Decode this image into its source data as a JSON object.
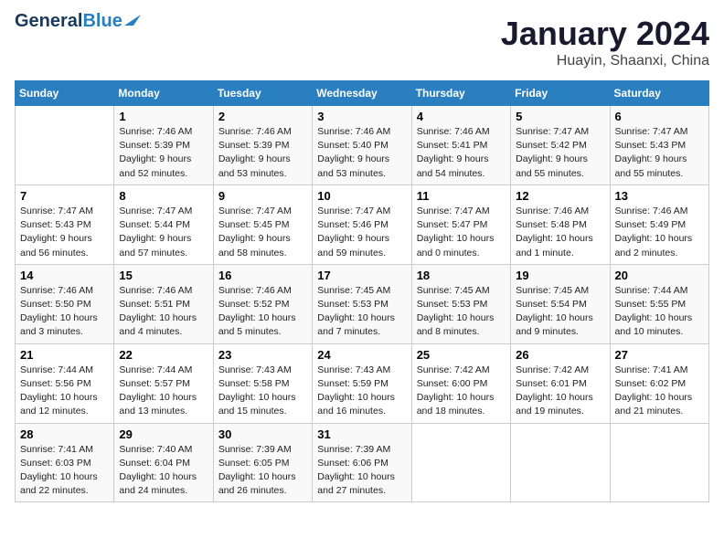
{
  "header": {
    "logo_general": "General",
    "logo_blue": "Blue",
    "month": "January 2024",
    "location": "Huayin, Shaanxi, China"
  },
  "days_of_week": [
    "Sunday",
    "Monday",
    "Tuesday",
    "Wednesday",
    "Thursday",
    "Friday",
    "Saturday"
  ],
  "weeks": [
    [
      {
        "day": "",
        "sunrise": "",
        "sunset": "",
        "daylight": ""
      },
      {
        "day": "1",
        "sunrise": "Sunrise: 7:46 AM",
        "sunset": "Sunset: 5:39 PM",
        "daylight": "Daylight: 9 hours and 52 minutes."
      },
      {
        "day": "2",
        "sunrise": "Sunrise: 7:46 AM",
        "sunset": "Sunset: 5:39 PM",
        "daylight": "Daylight: 9 hours and 53 minutes."
      },
      {
        "day": "3",
        "sunrise": "Sunrise: 7:46 AM",
        "sunset": "Sunset: 5:40 PM",
        "daylight": "Daylight: 9 hours and 53 minutes."
      },
      {
        "day": "4",
        "sunrise": "Sunrise: 7:46 AM",
        "sunset": "Sunset: 5:41 PM",
        "daylight": "Daylight: 9 hours and 54 minutes."
      },
      {
        "day": "5",
        "sunrise": "Sunrise: 7:47 AM",
        "sunset": "Sunset: 5:42 PM",
        "daylight": "Daylight: 9 hours and 55 minutes."
      },
      {
        "day": "6",
        "sunrise": "Sunrise: 7:47 AM",
        "sunset": "Sunset: 5:43 PM",
        "daylight": "Daylight: 9 hours and 55 minutes."
      }
    ],
    [
      {
        "day": "7",
        "sunrise": "Sunrise: 7:47 AM",
        "sunset": "Sunset: 5:43 PM",
        "daylight": "Daylight: 9 hours and 56 minutes."
      },
      {
        "day": "8",
        "sunrise": "Sunrise: 7:47 AM",
        "sunset": "Sunset: 5:44 PM",
        "daylight": "Daylight: 9 hours and 57 minutes."
      },
      {
        "day": "9",
        "sunrise": "Sunrise: 7:47 AM",
        "sunset": "Sunset: 5:45 PM",
        "daylight": "Daylight: 9 hours and 58 minutes."
      },
      {
        "day": "10",
        "sunrise": "Sunrise: 7:47 AM",
        "sunset": "Sunset: 5:46 PM",
        "daylight": "Daylight: 9 hours and 59 minutes."
      },
      {
        "day": "11",
        "sunrise": "Sunrise: 7:47 AM",
        "sunset": "Sunset: 5:47 PM",
        "daylight": "Daylight: 10 hours and 0 minutes."
      },
      {
        "day": "12",
        "sunrise": "Sunrise: 7:46 AM",
        "sunset": "Sunset: 5:48 PM",
        "daylight": "Daylight: 10 hours and 1 minute."
      },
      {
        "day": "13",
        "sunrise": "Sunrise: 7:46 AM",
        "sunset": "Sunset: 5:49 PM",
        "daylight": "Daylight: 10 hours and 2 minutes."
      }
    ],
    [
      {
        "day": "14",
        "sunrise": "Sunrise: 7:46 AM",
        "sunset": "Sunset: 5:50 PM",
        "daylight": "Daylight: 10 hours and 3 minutes."
      },
      {
        "day": "15",
        "sunrise": "Sunrise: 7:46 AM",
        "sunset": "Sunset: 5:51 PM",
        "daylight": "Daylight: 10 hours and 4 minutes."
      },
      {
        "day": "16",
        "sunrise": "Sunrise: 7:46 AM",
        "sunset": "Sunset: 5:52 PM",
        "daylight": "Daylight: 10 hours and 5 minutes."
      },
      {
        "day": "17",
        "sunrise": "Sunrise: 7:45 AM",
        "sunset": "Sunset: 5:53 PM",
        "daylight": "Daylight: 10 hours and 7 minutes."
      },
      {
        "day": "18",
        "sunrise": "Sunrise: 7:45 AM",
        "sunset": "Sunset: 5:53 PM",
        "daylight": "Daylight: 10 hours and 8 minutes."
      },
      {
        "day": "19",
        "sunrise": "Sunrise: 7:45 AM",
        "sunset": "Sunset: 5:54 PM",
        "daylight": "Daylight: 10 hours and 9 minutes."
      },
      {
        "day": "20",
        "sunrise": "Sunrise: 7:44 AM",
        "sunset": "Sunset: 5:55 PM",
        "daylight": "Daylight: 10 hours and 10 minutes."
      }
    ],
    [
      {
        "day": "21",
        "sunrise": "Sunrise: 7:44 AM",
        "sunset": "Sunset: 5:56 PM",
        "daylight": "Daylight: 10 hours and 12 minutes."
      },
      {
        "day": "22",
        "sunrise": "Sunrise: 7:44 AM",
        "sunset": "Sunset: 5:57 PM",
        "daylight": "Daylight: 10 hours and 13 minutes."
      },
      {
        "day": "23",
        "sunrise": "Sunrise: 7:43 AM",
        "sunset": "Sunset: 5:58 PM",
        "daylight": "Daylight: 10 hours and 15 minutes."
      },
      {
        "day": "24",
        "sunrise": "Sunrise: 7:43 AM",
        "sunset": "Sunset: 5:59 PM",
        "daylight": "Daylight: 10 hours and 16 minutes."
      },
      {
        "day": "25",
        "sunrise": "Sunrise: 7:42 AM",
        "sunset": "Sunset: 6:00 PM",
        "daylight": "Daylight: 10 hours and 18 minutes."
      },
      {
        "day": "26",
        "sunrise": "Sunrise: 7:42 AM",
        "sunset": "Sunset: 6:01 PM",
        "daylight": "Daylight: 10 hours and 19 minutes."
      },
      {
        "day": "27",
        "sunrise": "Sunrise: 7:41 AM",
        "sunset": "Sunset: 6:02 PM",
        "daylight": "Daylight: 10 hours and 21 minutes."
      }
    ],
    [
      {
        "day": "28",
        "sunrise": "Sunrise: 7:41 AM",
        "sunset": "Sunset: 6:03 PM",
        "daylight": "Daylight: 10 hours and 22 minutes."
      },
      {
        "day": "29",
        "sunrise": "Sunrise: 7:40 AM",
        "sunset": "Sunset: 6:04 PM",
        "daylight": "Daylight: 10 hours and 24 minutes."
      },
      {
        "day": "30",
        "sunrise": "Sunrise: 7:39 AM",
        "sunset": "Sunset: 6:05 PM",
        "daylight": "Daylight: 10 hours and 26 minutes."
      },
      {
        "day": "31",
        "sunrise": "Sunrise: 7:39 AM",
        "sunset": "Sunset: 6:06 PM",
        "daylight": "Daylight: 10 hours and 27 minutes."
      },
      {
        "day": "",
        "sunrise": "",
        "sunset": "",
        "daylight": ""
      },
      {
        "day": "",
        "sunrise": "",
        "sunset": "",
        "daylight": ""
      },
      {
        "day": "",
        "sunrise": "",
        "sunset": "",
        "daylight": ""
      }
    ]
  ]
}
